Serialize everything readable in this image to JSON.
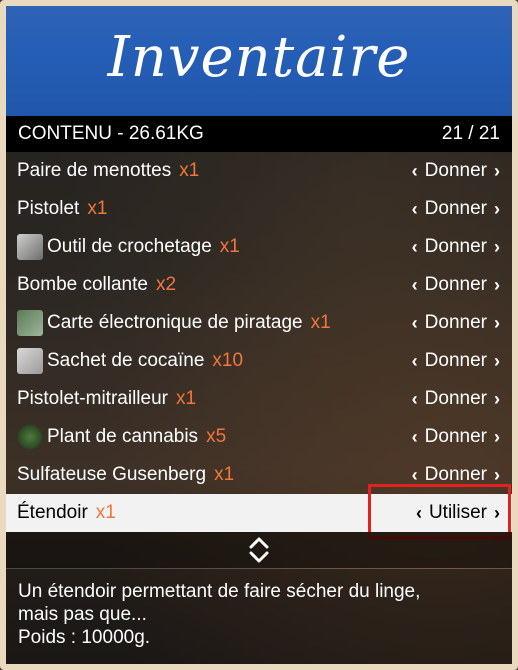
{
  "header": {
    "title": "Inventaire"
  },
  "subheader": {
    "title": "CONTENU - 26.61KG",
    "count": "21 / 21"
  },
  "items": [
    {
      "name": "Paire de menottes",
      "qty": "x1",
      "action": "Donner",
      "icon": ""
    },
    {
      "name": "Pistolet",
      "qty": "x1",
      "action": "Donner",
      "icon": ""
    },
    {
      "name": "Outil de crochetage",
      "qty": "x1",
      "action": "Donner",
      "icon": "lockpick-icon"
    },
    {
      "name": "Bombe collante",
      "qty": "x2",
      "action": "Donner",
      "icon": ""
    },
    {
      "name": "Carte électronique de piratage",
      "qty": "x1",
      "action": "Donner",
      "icon": "hacking-card-icon"
    },
    {
      "name": "Sachet de cocaïne",
      "qty": "x10",
      "action": "Donner",
      "icon": "cocaine-bag-icon"
    },
    {
      "name": "Pistolet-mitrailleur",
      "qty": "x1",
      "action": "Donner",
      "icon": ""
    },
    {
      "name": "Plant de cannabis",
      "qty": "x5",
      "action": "Donner",
      "icon": "cannabis-plant-icon"
    },
    {
      "name": "Sulfateuse Gusenberg",
      "qty": "x1",
      "action": "Donner",
      "icon": ""
    },
    {
      "name": "Étendoir",
      "qty": "x1",
      "action": "Utiliser",
      "icon": ""
    }
  ],
  "selected_index": 9,
  "description": {
    "line1": "Un étendoir permettant de faire sécher du linge,",
    "line2": "mais pas que...",
    "weight": "Poids : 10000g."
  }
}
